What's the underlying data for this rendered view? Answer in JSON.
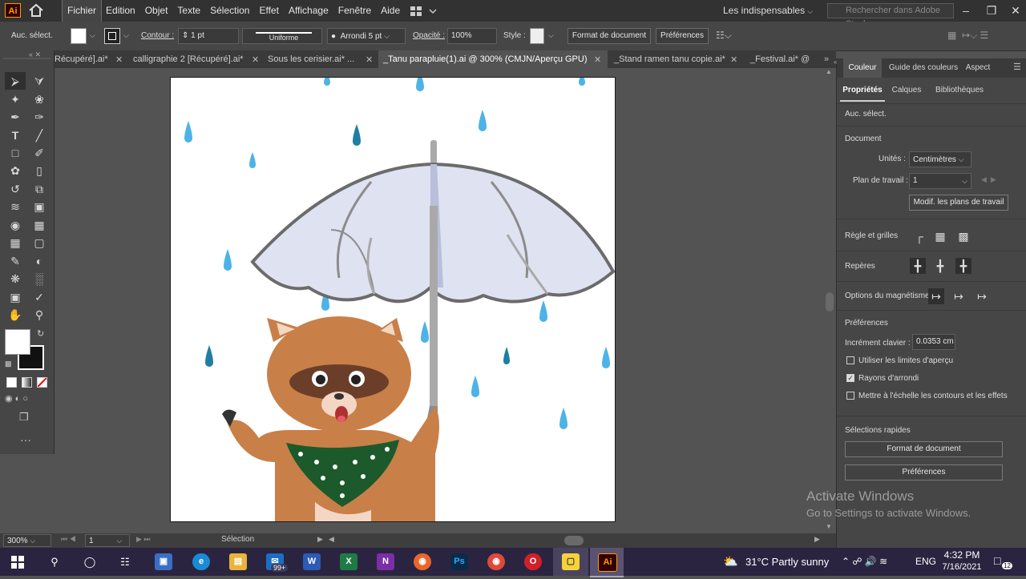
{
  "menubar": {
    "logo": "Ai",
    "menus": [
      "Fichier",
      "Edition",
      "Objet",
      "Texte",
      "Sélection",
      "Effet",
      "Affichage",
      "Fenêtre",
      "Aide"
    ],
    "workspace": "Les indispensables",
    "search_placeholder": "Rechercher dans Adobe Stock"
  },
  "control": {
    "selection": "Auc. sélect.",
    "contour_label": "Contour :",
    "contour_value": "1 pt",
    "stroke_profile": "Uniforme",
    "brush": "Arrondi 5 pt",
    "opacity_label": "Opacité :",
    "opacity_value": "100%",
    "style_label": "Style :",
    "doc_format_button": "Format de document",
    "prefs_button": "Préférences"
  },
  "tabs": [
    {
      "label": "Récupéré].ai*",
      "active": false
    },
    {
      "label": "calligraphie 2 [Récupéré].ai*",
      "active": false
    },
    {
      "label": "Sous les cerisier.ai* ...",
      "active": false
    },
    {
      "label": "_Tanu parapluie(1).ai @ 300% (CMJN/Aperçu GPU)",
      "active": true
    },
    {
      "label": "_Stand ramen tanu copie.ai*",
      "active": false
    },
    {
      "label": "_Festival.ai* @",
      "active": false
    }
  ],
  "status": {
    "zoom": "300%",
    "artboard_num": "1",
    "tool": "Sélection"
  },
  "panel": {
    "top_tabs": [
      "Couleur",
      "Guide des couleurs",
      "Aspect"
    ],
    "sub_tabs": [
      "Propriétés",
      "Calques",
      "Bibliothèques"
    ],
    "selection": "Auc. sélect.",
    "document_title": "Document",
    "units_label": "Unités :",
    "units_value": "Centimètres",
    "artboard_label": "Plan de travail :",
    "artboard_value": "1",
    "edit_artboards_button": "Modif. les plans de travail",
    "rulers_label": "Règle et grilles",
    "guides_label": "Repères",
    "snap_label": "Options du magnétisme",
    "prefs_title": "Préférences",
    "keyboard_inc_label": "Incrément clavier :",
    "keyboard_inc_value": "0.0353 cm",
    "check_preview_bounds": "Utiliser les limites d'aperçu",
    "check_rounded_corners": "Rayons d'arrondi",
    "check_scale_strokes": "Mettre à l'échelle les contours et les effets",
    "quick_actions_title": "Sélections rapides",
    "quick_doc_format": "Format de document",
    "quick_prefs": "Préférences"
  },
  "watermark": {
    "line1": "Activate Windows",
    "line2": "Go to Settings to activate Windows."
  },
  "taskbar": {
    "mail_badge": "99+",
    "weather": "31°C  Partly sunny",
    "lang": "ENG",
    "time": "4:32 PM",
    "date": "7/16/2021",
    "notif_count": "12"
  }
}
